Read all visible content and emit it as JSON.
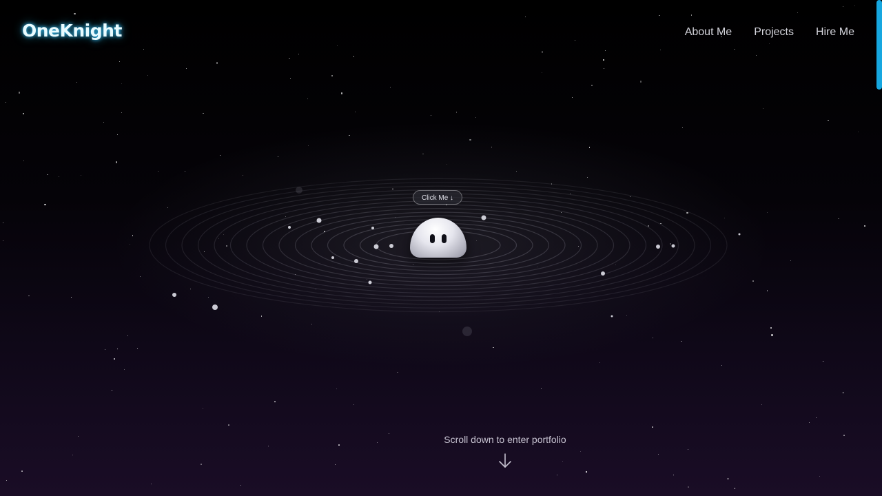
{
  "header": {
    "logo": "OneKnight",
    "nav": [
      {
        "label": "About Me"
      },
      {
        "label": "Projects"
      },
      {
        "label": "Hire Me"
      }
    ]
  },
  "hero": {
    "click_button": "Click Me ↓",
    "mascot_icon": "blob-mascot-icon",
    "scroll_text": "Scroll down to enter portfolio",
    "scroll_icon": "arrow-down-icon"
  },
  "colors": {
    "logo_glow": "#37c6ff",
    "scrollbar": "#16a7e0",
    "background_bottom": "#1a0d26"
  }
}
